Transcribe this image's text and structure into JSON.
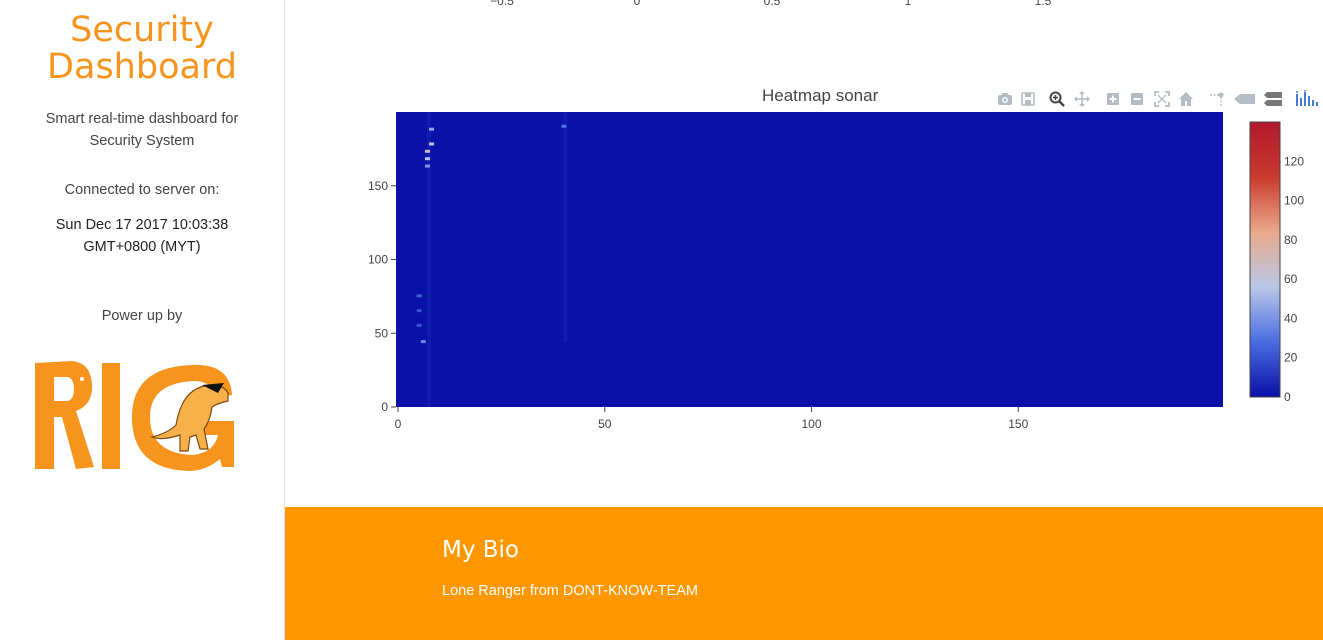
{
  "sidebar": {
    "brand_line1": "Security",
    "brand_line2": "Dashboard",
    "subtitle": "Smart real-time dashboard for Security System",
    "connected_label": "Connected to server on:",
    "connected_time": "Sun Dec 17 2017 10:03:38 GMT+0800 (MYT)",
    "power_label": "Power up by",
    "logo_text": "RIG"
  },
  "previous_chart": {
    "x_ticks": [
      "−0.5",
      "0",
      "0.5",
      "1",
      "1.5"
    ]
  },
  "chart_data": {
    "type": "heatmap",
    "title": "Heatmap sonar",
    "x_ticks": [
      "0",
      "50",
      "100",
      "150"
    ],
    "y_ticks": [
      "0",
      "50",
      "100",
      "150"
    ],
    "xlim": [
      0,
      200
    ],
    "ylim": [
      0,
      200
    ],
    "colorbar": {
      "ticks": [
        "0",
        "20",
        "40",
        "60",
        "80",
        "100",
        "120"
      ],
      "range": [
        0,
        140
      ],
      "colorscale": [
        "#0a10a8",
        "#4a6de0",
        "#b9c7e8",
        "#e9a98a",
        "#c93a2e",
        "#b2182b"
      ]
    },
    "background_value": 0,
    "hotspots": [
      {
        "x": 8,
        "y": 188,
        "value": 45
      },
      {
        "x": 8,
        "y": 178,
        "value": 60
      },
      {
        "x": 7,
        "y": 173,
        "value": 70
      },
      {
        "x": 7,
        "y": 168,
        "value": 55
      },
      {
        "x": 7,
        "y": 163,
        "value": 40
      },
      {
        "x": 40,
        "y": 190,
        "value": 30
      },
      {
        "x": 5,
        "y": 75,
        "value": 25
      },
      {
        "x": 5,
        "y": 65,
        "value": 20
      },
      {
        "x": 5,
        "y": 55,
        "value": 20
      },
      {
        "x": 6,
        "y": 44,
        "value": 35
      }
    ],
    "colors": {
      "background_cell": "#0a10a8"
    }
  },
  "modebar": {
    "icons": [
      "camera-icon",
      "save-icon",
      "zoom-icon",
      "pan-icon",
      "zoom-in-icon",
      "zoom-out-icon",
      "autoscale-icon",
      "reset-axes-icon",
      "spike-lines-icon",
      "hover-closest-icon",
      "hover-compare-icon",
      "plotly-logo-icon"
    ]
  },
  "footer": {
    "title": "My Bio",
    "text": "Lone Ranger from DONT-KNOW-TEAM",
    "color": "#ff9800"
  },
  "colors": {
    "accent": "#f7941d",
    "modebar_icon": "#b4bcc6",
    "plotly_blue": "#447adb"
  }
}
